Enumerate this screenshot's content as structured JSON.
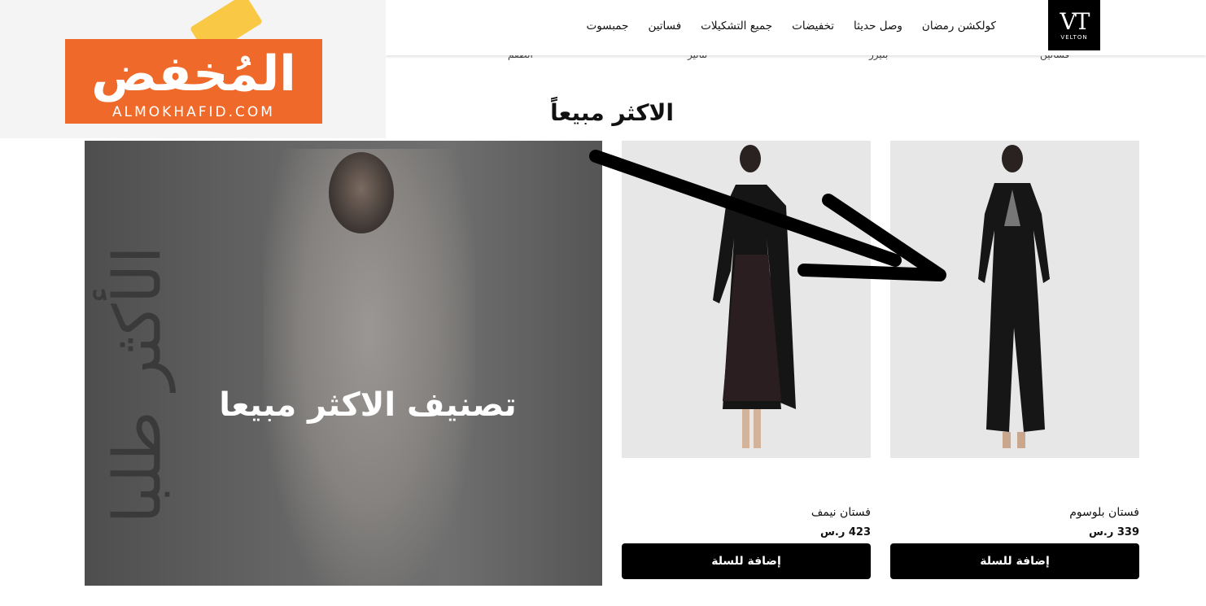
{
  "watermark": {
    "arabic": "المُخفض",
    "latin": "ALMOKHAFID.COM"
  },
  "header": {
    "brand_mono": "VT",
    "brand_name": "VELTON",
    "nav": [
      "كولكشن رمضان",
      "وصل حديثا",
      "تخفيضات",
      "جميع التشكيلات",
      "فساتين",
      "جمبسوت"
    ],
    "subnav": [
      "فساتين",
      "بليزر",
      "تنانير",
      "الطقم"
    ]
  },
  "section": {
    "title": "الاكثر مبيعاً"
  },
  "banner": {
    "vertical_text": "الأكثر طلبا",
    "caption": "تصنيف الاكثر مبيعا"
  },
  "products": [
    {
      "title": "فستان بلوسوم",
      "price": "339 ر.س",
      "button": "إضافة للسلة"
    },
    {
      "title": "فستان نيمف",
      "price": "423 ر.س",
      "button": "إضافة للسلة"
    }
  ],
  "colors": {
    "accent": "#ef6a2a",
    "button": "#000000"
  }
}
